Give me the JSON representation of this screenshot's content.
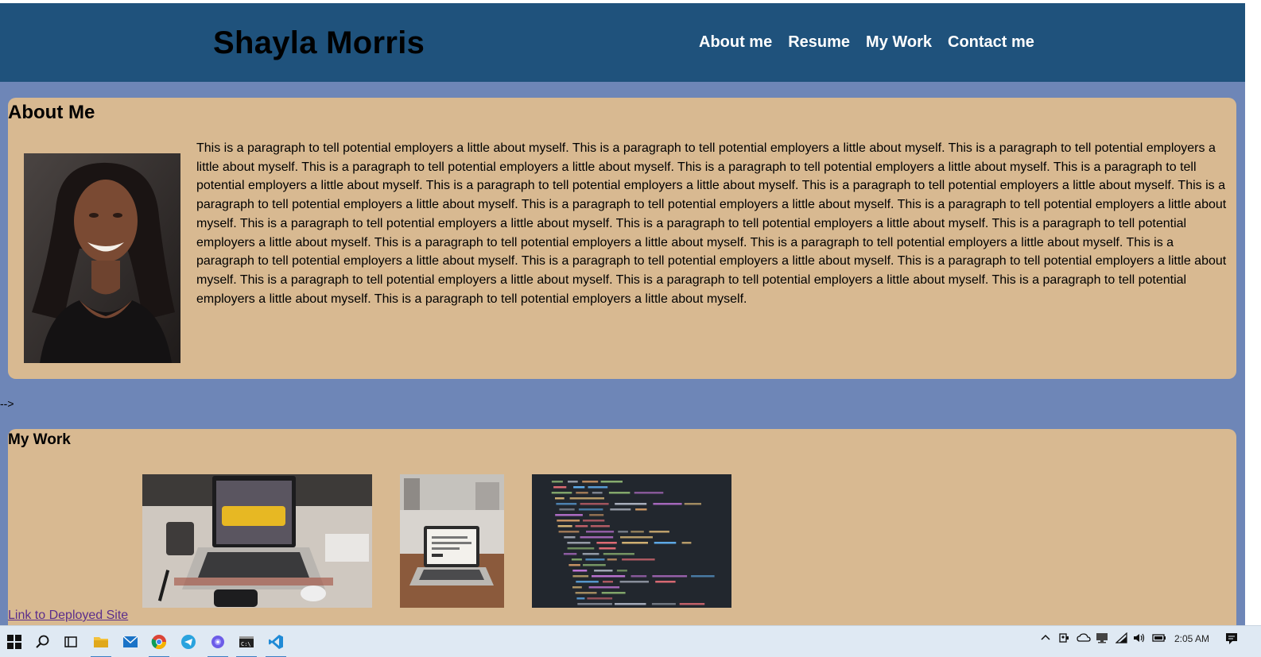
{
  "header": {
    "title": "Shayla Morris",
    "nav": [
      "About me",
      "Resume",
      "My Work",
      "Contact me"
    ]
  },
  "about": {
    "heading": "About Me",
    "paragraph": "This is a paragraph to tell potential employers a little about myself. This is a paragraph to tell potential employers a little about myself. This is a paragraph to tell potential employers a little about myself. This is a paragraph to tell potential employers a little about myself. This is a paragraph to tell potential employers a little about myself. This is a paragraph to tell potential employers a little about myself. This is a paragraph to tell potential employers a little about myself. This is a paragraph to tell potential employers a little about myself. This is a paragraph to tell potential employers a little about myself. This is a paragraph to tell potential employers a little about myself. This is a paragraph to tell potential employers a little about myself. This is a paragraph to tell potential employers a little about myself. This is a paragraph to tell potential employers a little about myself. This is a paragraph to tell potential employers a little about myself. This is a paragraph to tell potential employers a little about myself. This is a paragraph to tell potential employers a little about myself. This is a paragraph to tell potential employers a little about myself. This is a paragraph to tell potential employers a little about myself. This is a paragraph to tell potential employers a little about myself. This is a paragraph to tell potential employers a little about myself. This is a paragraph to tell potential employers a little about myself. This is a paragraph to tell potential employers a little about myself. This is a paragraph to tell potential employers a little about myself."
  },
  "stray_text": "-->",
  "work": {
    "heading": "My Work",
    "link": "Link to Deployed Site"
  },
  "taskbar": {
    "clock": "2:05 AM",
    "pinned_icons": [
      "windows-start-icon",
      "search-icon",
      "task-view-icon",
      "file-explorer-icon",
      "mail-icon",
      "chrome-icon",
      "telegram-icon",
      "app-icon",
      "terminal-icon",
      "vscode-icon"
    ],
    "tray_icons": [
      "chevron-up-icon",
      "meet-now-icon",
      "onedrive-icon",
      "display-icon",
      "wifi-icon",
      "volume-icon",
      "battery-icon",
      "notification-icon"
    ]
  },
  "colors": {
    "header_bg": "#1f527c",
    "page_bg": "#6e86b7",
    "card_bg": "#d8b991",
    "link": "#5b2e8c"
  }
}
